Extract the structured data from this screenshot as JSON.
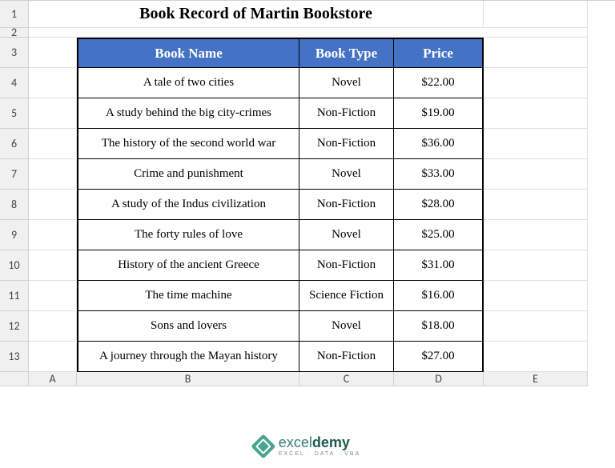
{
  "columns": [
    "A",
    "B",
    "C",
    "D",
    "E"
  ],
  "rows": [
    "1",
    "2",
    "3",
    "4",
    "5",
    "6",
    "7",
    "8",
    "9",
    "10",
    "11",
    "12",
    "13"
  ],
  "title": "Book Record of Martin Bookstore",
  "headers": {
    "name": "Book Name",
    "type": "Book Type",
    "price": "Price"
  },
  "data": [
    {
      "name": "A tale of two cities",
      "type": "Novel",
      "price": "$22.00"
    },
    {
      "name": "A study behind the big city-crimes",
      "type": "Non-Fiction",
      "price": "$19.00"
    },
    {
      "name": "The history of the second world war",
      "type": "Non-Fiction",
      "price": "$36.00"
    },
    {
      "name": "Crime and punishment",
      "type": "Novel",
      "price": "$33.00"
    },
    {
      "name": "A study of the Indus civilization",
      "type": "Non-Fiction",
      "price": "$28.00"
    },
    {
      "name": "The forty rules of love",
      "type": "Novel",
      "price": "$25.00"
    },
    {
      "name": "History of the ancient Greece",
      "type": "Non-Fiction",
      "price": "$31.00"
    },
    {
      "name": "The time machine",
      "type": "Science Fiction",
      "price": "$16.00"
    },
    {
      "name": "Sons and lovers",
      "type": "Novel",
      "price": "$18.00"
    },
    {
      "name": "A journey through the Mayan history",
      "type": "Non-Fiction",
      "price": "$27.00"
    }
  ],
  "watermark": {
    "brand_prefix": "excel",
    "brand_suffix": "demy",
    "tag": "EXCEL · DATA · VBA"
  }
}
